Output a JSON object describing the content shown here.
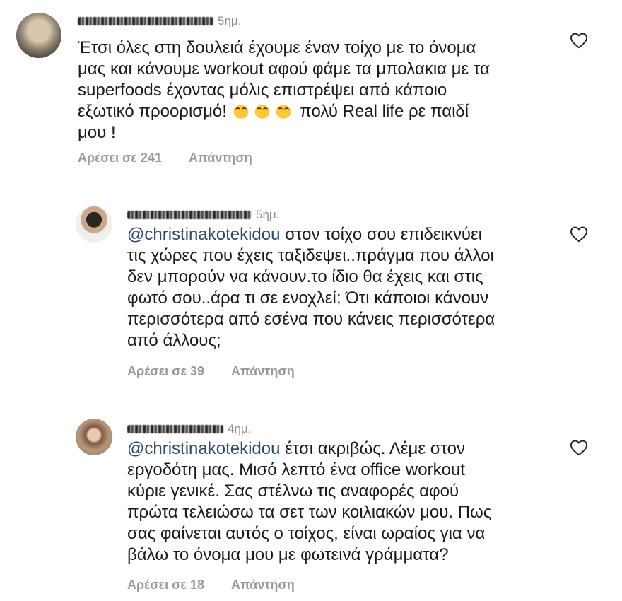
{
  "comments": [
    {
      "time": "5ημ.",
      "lines": [
        "Έτσι όλες στη δουλειά έχουμε έναν τοίχο με το όνομα",
        "μας και κάνουμε workout αφού φάμε τα μπολακια με τα",
        "superfoods έχοντας μόλις επιστρέψει από κάποιο",
        "εξωτικό προορισμό!",
        "πολύ Real life ρε παιδί",
        "μου !"
      ],
      "emoji": [
        "laughing-cat-emoji",
        "laughing-cat-emoji",
        "laughing-cat-emoji"
      ],
      "likes": "Αρέσει σε 241",
      "reply": "Απάντηση"
    },
    {
      "time": "5ημ.",
      "mention": "@christinakotekidou",
      "lines": [
        "στον τοίχο σου επιδεικνύει",
        "τις χώρες που έχεις ταξιδεψει..πράγμα που άλλοι",
        "δεν μπορούν να κάνουν.το ίδιο θα έχεις και στις",
        "φωτό σου..άρα τι σε ενοχλεί; Ότι κάποιοι κάνουν",
        "περισσότερα από εσένα που κάνεις περισσότερα",
        "από άλλους;"
      ],
      "likes": "Αρέσει σε 39",
      "reply": "Απάντηση"
    },
    {
      "time": "4ημ.",
      "mention": "@christinakotekidou",
      "lines": [
        "έτσι ακριβώς. Λέμε στον",
        "εργοδότη μας. Μισό λεπτό ένα office workout",
        "κύριε γενικέ. Σας στέλνω τις αναφορές αφού",
        "πρώτα τελειώσω τα σετ των κοιλιακών μου. Πως",
        "σας φαίνεται αυτός ο τοίχος, είναι ωραίος για να",
        "βάλω το όνομα μου με φωτεινά γράμματα?"
      ],
      "likes": "Αρέσει σε 18",
      "reply": "Απάντηση"
    }
  ],
  "icons": {
    "like": "heart-outline-icon"
  },
  "colors": {
    "mention": "#2b4a6e",
    "muted": "#8e8e8e",
    "actions": "#9a9a9a"
  }
}
